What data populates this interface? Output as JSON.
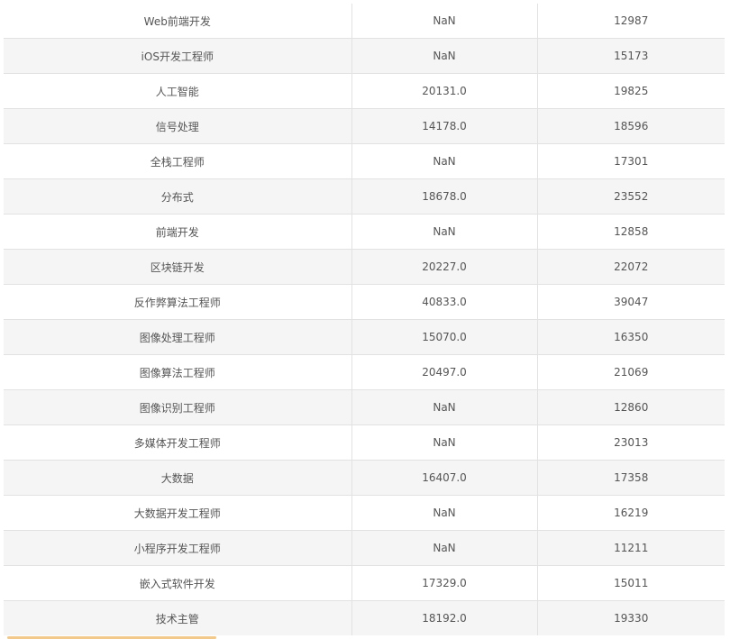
{
  "table": {
    "rows": [
      [
        "Web前端开发",
        "NaN",
        "12987"
      ],
      [
        "iOS开发工程师",
        "NaN",
        "15173"
      ],
      [
        "人工智能",
        "20131.0",
        "19825"
      ],
      [
        "信号处理",
        "14178.0",
        "18596"
      ],
      [
        "全栈工程师",
        "NaN",
        "17301"
      ],
      [
        "分布式",
        "18678.0",
        "23552"
      ],
      [
        "前端开发",
        "NaN",
        "12858"
      ],
      [
        "区块链开发",
        "20227.0",
        "22072"
      ],
      [
        "反作弊算法工程师",
        "40833.0",
        "39047"
      ],
      [
        "图像处理工程师",
        "15070.0",
        "16350"
      ],
      [
        "图像算法工程师",
        "20497.0",
        "21069"
      ],
      [
        "图像识别工程师",
        "NaN",
        "12860"
      ],
      [
        "多媒体开发工程师",
        "NaN",
        "23013"
      ],
      [
        "大数据",
        "16407.0",
        "17358"
      ],
      [
        "大数据开发工程师",
        "NaN",
        "16219"
      ],
      [
        "小程序开发工程师",
        "NaN",
        "11211"
      ],
      [
        "嵌入式软件开发",
        "17329.0",
        "15011"
      ],
      [
        "技术主管",
        "18192.0",
        "19330"
      ]
    ]
  },
  "colors": {
    "stripe": "#f5f5f5",
    "border": "#e2e2e2",
    "text": "#555555",
    "accent": "#f2c98a"
  }
}
